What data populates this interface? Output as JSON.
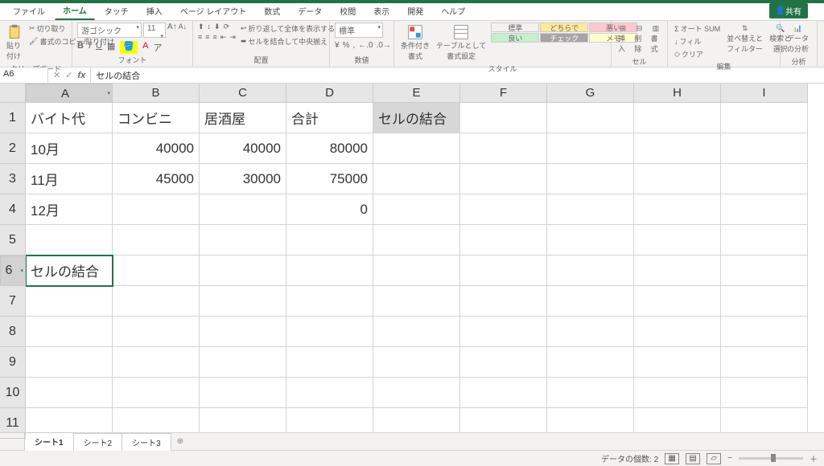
{
  "tabs": {
    "file": "ファイル",
    "home": "ホーム",
    "touch": "タッチ",
    "insert": "挿入",
    "layout": "ページ レイアウト",
    "formulas": "数式",
    "data": "データ",
    "review": "校閲",
    "view": "表示",
    "dev": "開発",
    "help": "ヘルプ"
  },
  "share": "共有",
  "ribbon": {
    "clipboard": {
      "paste": "貼り付け",
      "cut": "切り取り",
      "copy_fmt": "書式のコピー/貼り付け",
      "label": "クリップボード"
    },
    "font": {
      "name": "游ゴシック",
      "size": "11",
      "label": "フォント"
    },
    "align": {
      "wrap": "折り返して全体を表示する",
      "merge": "セルを結合して中央揃え",
      "label": "配置"
    },
    "number": {
      "format": "標準",
      "label": "数値"
    },
    "styles": {
      "cond": "条件付き\n書式",
      "tbl": "テーブルとして\n書式設定",
      "normal": "標準",
      "dochira": "どちらでも…",
      "bad": "悪い",
      "good": "良い",
      "check": "チェック セ…",
      "memo": "メモ",
      "label": "スタイル"
    },
    "cells": {
      "insert": "挿入",
      "delete": "削除",
      "format": "書式",
      "label": "セル"
    },
    "editing": {
      "sum": "オート SUM",
      "fill": "フィル",
      "clear": "クリア",
      "sort": "並べ替えと\nフィルター",
      "find": "検索と\n選択",
      "label": "編集"
    },
    "analysis": {
      "btn": "データ\nの分析",
      "label": "分析"
    }
  },
  "namebox": "A6",
  "formula": "セルの結合",
  "columns": [
    "A",
    "B",
    "C",
    "D",
    "E",
    "F",
    "G",
    "H",
    "I"
  ],
  "rows": [
    [
      "バイト代",
      "コンビニ",
      "居酒屋",
      "合計",
      "セルの結合",
      "",
      "",
      "",
      ""
    ],
    [
      "10月",
      "40000",
      "40000",
      "80000",
      "",
      "",
      "",
      "",
      ""
    ],
    [
      "11月",
      "45000",
      "30000",
      "75000",
      "",
      "",
      "",
      "",
      ""
    ],
    [
      "12月",
      "",
      "",
      "0",
      "",
      "",
      "",
      "",
      ""
    ],
    [
      "",
      "",
      "",
      "",
      "",
      "",
      "",
      "",
      ""
    ],
    [
      "セルの結合",
      "",
      "",
      "",
      "",
      "",
      "",
      "",
      ""
    ],
    [
      "",
      "",
      "",
      "",
      "",
      "",
      "",
      "",
      ""
    ],
    [
      "",
      "",
      "",
      "",
      "",
      "",
      "",
      "",
      ""
    ],
    [
      "",
      "",
      "",
      "",
      "",
      "",
      "",
      "",
      ""
    ],
    [
      "",
      "",
      "",
      "",
      "",
      "",
      "",
      "",
      ""
    ],
    [
      "",
      "",
      "",
      "",
      "",
      "",
      "",
      "",
      ""
    ]
  ],
  "sheets": {
    "s1": "シート1",
    "s2": "シート2",
    "s3": "シート3"
  },
  "status": {
    "count": "データの個数: 2"
  }
}
